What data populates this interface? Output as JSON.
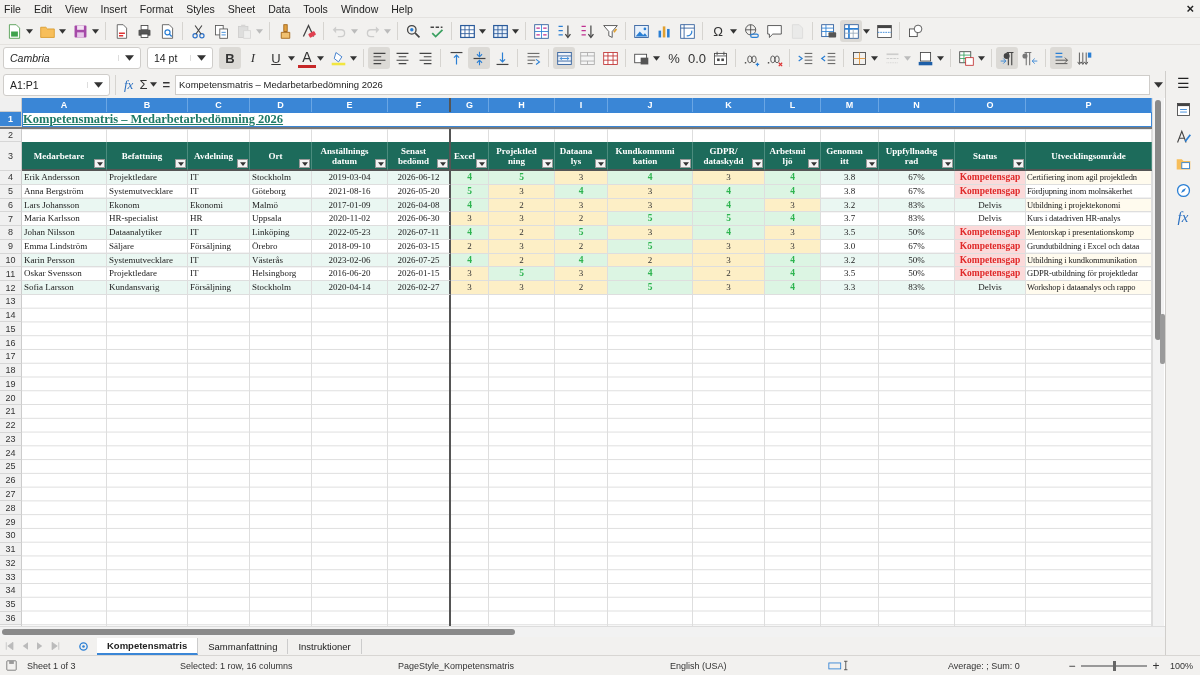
{
  "menu": [
    "File",
    "Edit",
    "View",
    "Insert",
    "Format",
    "Styles",
    "Sheet",
    "Data",
    "Tools",
    "Window",
    "Help"
  ],
  "close": "×",
  "toolbar_1": [
    {
      "kind": "newdoc",
      "selected": false,
      "disabled": false,
      "dropdown": true
    },
    {
      "kind": "open",
      "selected": false,
      "disabled": false,
      "dropdown": true
    },
    {
      "kind": "save",
      "selected": false,
      "disabled": false,
      "dropdown": true
    },
    {
      "kind": "sep"
    },
    {
      "kind": "pdf",
      "selected": false,
      "disabled": false,
      "dropdown": false
    },
    {
      "kind": "print",
      "selected": false,
      "disabled": false,
      "dropdown": false
    },
    {
      "kind": "preview",
      "selected": false,
      "disabled": false,
      "dropdown": false
    },
    {
      "kind": "sep"
    },
    {
      "kind": "cut",
      "selected": false,
      "disabled": false,
      "dropdown": false
    },
    {
      "kind": "copy",
      "selected": false,
      "disabled": false,
      "dropdown": false
    },
    {
      "kind": "paste",
      "selected": false,
      "disabled": true,
      "dropdown": true
    },
    {
      "kind": "sep"
    },
    {
      "kind": "brush",
      "selected": false,
      "disabled": false,
      "dropdown": false
    },
    {
      "kind": "eraser",
      "selected": false,
      "disabled": false,
      "dropdown": false
    },
    {
      "kind": "sep"
    },
    {
      "kind": "undo",
      "selected": false,
      "disabled": true,
      "dropdown": true
    },
    {
      "kind": "redo",
      "selected": false,
      "disabled": true,
      "dropdown": true
    },
    {
      "kind": "sep"
    },
    {
      "kind": "find",
      "selected": false,
      "disabled": false,
      "dropdown": false
    },
    {
      "kind": "spell",
      "selected": false,
      "disabled": false,
      "dropdown": false
    },
    {
      "kind": "sep"
    },
    {
      "kind": "rows",
      "selected": false,
      "disabled": false,
      "dropdown": true
    },
    {
      "kind": "cols",
      "selected": false,
      "disabled": false,
      "dropdown": true
    },
    {
      "kind": "sep"
    },
    {
      "kind": "sort",
      "selected": false,
      "disabled": false,
      "dropdown": false
    },
    {
      "kind": "sortup",
      "selected": false,
      "disabled": false,
      "dropdown": false
    },
    {
      "kind": "sortdown",
      "selected": false,
      "disabled": false,
      "dropdown": false
    },
    {
      "kind": "filter",
      "selected": false,
      "disabled": false,
      "dropdown": false
    },
    {
      "kind": "sep"
    },
    {
      "kind": "image",
      "selected": false,
      "disabled": false,
      "dropdown": false
    },
    {
      "kind": "chart",
      "selected": false,
      "disabled": false,
      "dropdown": false
    },
    {
      "kind": "pivot",
      "selected": false,
      "disabled": false,
      "dropdown": false
    },
    {
      "kind": "sep"
    },
    {
      "kind": "glyph",
      "label": "Ω",
      "selected": false,
      "disabled": false,
      "dropdown": true
    },
    {
      "kind": "link",
      "selected": false,
      "disabled": false,
      "dropdown": false
    },
    {
      "kind": "comment",
      "selected": false,
      "disabled": false,
      "dropdown": false
    },
    {
      "kind": "page",
      "selected": false,
      "disabled": true,
      "dropdown": false
    },
    {
      "kind": "sep"
    },
    {
      "kind": "printarea",
      "selected": false,
      "disabled": false,
      "dropdown": false
    },
    {
      "kind": "freeze",
      "selected": true,
      "disabled": false,
      "dropdown": true
    },
    {
      "kind": "split",
      "selected": false,
      "disabled": false,
      "dropdown": false
    },
    {
      "kind": "sep"
    },
    {
      "kind": "shapes",
      "selected": false,
      "disabled": false,
      "dropdown": false
    }
  ],
  "font_name": "Cambria",
  "font_size": "14 pt",
  "toolbar_2": [
    {
      "kind": "glyph",
      "label": "B",
      "selected": true,
      "disabled": false,
      "dropdown": false
    },
    {
      "kind": "glyph",
      "label": "I",
      "selected": false,
      "disabled": false,
      "dropdown": false
    },
    {
      "kind": "glyph",
      "label": "U",
      "selected": false,
      "disabled": false,
      "dropdown": true
    },
    {
      "kind": "fontcolor",
      "label": "A",
      "selected": false,
      "disabled": false,
      "dropdown": true
    },
    {
      "kind": "highlight",
      "selected": false,
      "disabled": false,
      "dropdown": true
    },
    {
      "kind": "sep"
    },
    {
      "kind": "alignleft",
      "selected": true,
      "disabled": false,
      "dropdown": false
    },
    {
      "kind": "aligncenter",
      "selected": false,
      "disabled": false,
      "dropdown": false
    },
    {
      "kind": "alignright",
      "selected": false,
      "disabled": false,
      "dropdown": false
    },
    {
      "kind": "sep"
    },
    {
      "kind": "top",
      "selected": false,
      "disabled": false,
      "dropdown": false
    },
    {
      "kind": "vcenter",
      "selected": true,
      "disabled": false,
      "dropdown": false
    },
    {
      "kind": "bottom",
      "selected": false,
      "disabled": false,
      "dropdown": false
    },
    {
      "kind": "sep"
    },
    {
      "kind": "wrap",
      "selected": false,
      "disabled": false,
      "dropdown": false
    },
    {
      "kind": "sep"
    },
    {
      "kind": "mergecenter",
      "selected": true,
      "disabled": false,
      "dropdown": false
    },
    {
      "kind": "merge",
      "selected": false,
      "disabled": false,
      "dropdown": false
    },
    {
      "kind": "unmerge",
      "selected": false,
      "disabled": false,
      "dropdown": false
    },
    {
      "kind": "sep"
    },
    {
      "kind": "numfmt",
      "selected": false,
      "disabled": false,
      "dropdown": true
    },
    {
      "kind": "glyph",
      "label": "%",
      "selected": false,
      "disabled": false,
      "dropdown": false
    },
    {
      "kind": "glyph",
      "label": "0.0",
      "selected": false,
      "disabled": false,
      "dropdown": false
    },
    {
      "kind": "date",
      "selected": false,
      "disabled": false,
      "dropdown": false
    },
    {
      "kind": "sep"
    },
    {
      "kind": "adddec",
      "selected": false,
      "disabled": false,
      "dropdown": false
    },
    {
      "kind": "deldec",
      "selected": false,
      "disabled": false,
      "dropdown": false
    },
    {
      "kind": "sep"
    },
    {
      "kind": "indent",
      "selected": false,
      "disabled": false,
      "dropdown": false
    },
    {
      "kind": "outdent",
      "selected": false,
      "disabled": false,
      "dropdown": false
    },
    {
      "kind": "sep"
    },
    {
      "kind": "borders",
      "selected": false,
      "disabled": false,
      "dropdown": true
    },
    {
      "kind": "borderstyle",
      "selected": false,
      "disabled": true,
      "dropdown": true
    },
    {
      "kind": "bordercolor",
      "selected": false,
      "disabled": false,
      "dropdown": true
    },
    {
      "kind": "sep"
    },
    {
      "kind": "condfmt",
      "selected": false,
      "disabled": false,
      "dropdown": true
    },
    {
      "kind": "sep"
    },
    {
      "kind": "ltr",
      "selected": true,
      "disabled": false,
      "dropdown": false
    },
    {
      "kind": "rtl",
      "selected": false,
      "disabled": false,
      "dropdown": false
    },
    {
      "kind": "sep"
    },
    {
      "kind": "textdir",
      "selected": true,
      "disabled": false,
      "dropdown": false
    },
    {
      "kind": "vtext",
      "selected": false,
      "disabled": false,
      "dropdown": false
    }
  ],
  "formula_bar": {
    "name_box": "A1:P1",
    "function_wizard": "fx",
    "sum": "Σ",
    "equals": "=",
    "content": "Kompetensmatris – Medarbetarbedömning 2026"
  },
  "sidebar": {
    "menu": "☰",
    "functions": "fx"
  },
  "sheet": {
    "column_headers": [
      {
        "label": "A",
        "selected": true
      },
      {
        "label": "B",
        "selected": true
      },
      {
        "label": "C",
        "selected": true
      },
      {
        "label": "D",
        "selected": true
      },
      {
        "label": "E",
        "selected": true
      },
      {
        "label": "F",
        "selected": true
      },
      {
        "label": "G",
        "selected": true
      },
      {
        "label": "H",
        "selected": true
      },
      {
        "label": "I",
        "selected": true
      },
      {
        "label": "J",
        "selected": true
      },
      {
        "label": "K",
        "selected": true
      },
      {
        "label": "L",
        "selected": true
      },
      {
        "label": "M",
        "selected": true
      },
      {
        "label": "N",
        "selected": true
      },
      {
        "label": "O",
        "selected": true
      },
      {
        "label": "P",
        "selected": true
      }
    ],
    "row_headers": [
      {
        "label": "1",
        "selected": true
      },
      {
        "label": "2",
        "selected": false
      },
      {
        "label": "3",
        "selected": false
      },
      {
        "label": "4",
        "selected": false
      },
      {
        "label": "5",
        "selected": false
      },
      {
        "label": "6",
        "selected": false
      },
      {
        "label": "7",
        "selected": false
      },
      {
        "label": "8",
        "selected": false
      },
      {
        "label": "9",
        "selected": false
      },
      {
        "label": "10",
        "selected": false
      },
      {
        "label": "11",
        "selected": false
      },
      {
        "label": "12",
        "selected": false
      },
      {
        "label": "13",
        "selected": false
      },
      {
        "label": "14",
        "selected": false
      },
      {
        "label": "15",
        "selected": false
      },
      {
        "label": "16",
        "selected": false
      },
      {
        "label": "17",
        "selected": false
      },
      {
        "label": "18",
        "selected": false
      },
      {
        "label": "19",
        "selected": false
      },
      {
        "label": "20",
        "selected": false
      },
      {
        "label": "21",
        "selected": false
      },
      {
        "label": "22",
        "selected": false
      },
      {
        "label": "23",
        "selected": false
      },
      {
        "label": "24",
        "selected": false
      },
      {
        "label": "25",
        "selected": false
      },
      {
        "label": "26",
        "selected": false
      },
      {
        "label": "27",
        "selected": false
      },
      {
        "label": "28",
        "selected": false
      },
      {
        "label": "29",
        "selected": false
      },
      {
        "label": "30",
        "selected": false
      },
      {
        "label": "31",
        "selected": false
      },
      {
        "label": "32",
        "selected": false
      },
      {
        "label": "33",
        "selected": false
      },
      {
        "label": "34",
        "selected": false
      },
      {
        "label": "35",
        "selected": false
      },
      {
        "label": "36",
        "selected": false
      }
    ],
    "title": "Kompetensmatris – Medarbetarbedömning 2026",
    "header_cells": [
      {
        "text": "Medarbetare",
        "filter": true
      },
      {
        "text": "Befattning",
        "filter": true
      },
      {
        "text": "Avdelning",
        "filter": true
      },
      {
        "text": "Ort",
        "filter": true
      },
      {
        "text": "Anställnings\ndatum",
        "filter": true
      },
      {
        "text": "Senast\nbedömd",
        "filter": true
      },
      {
        "text": "Excel",
        "filter": true
      },
      {
        "text": "Projektled\nning",
        "filter": true
      },
      {
        "text": "Dataana\nlys",
        "filter": true
      },
      {
        "text": "Kundkommuni\nkation",
        "filter": true
      },
      {
        "text": "GDPR/\ndataskydd",
        "filter": true
      },
      {
        "text": "Arbetsmi\nljö",
        "filter": true
      },
      {
        "text": "Genomsn\nitt",
        "filter": true
      },
      {
        "text": "Uppfyllnadsg\nrad",
        "filter": true
      },
      {
        "text": "Status",
        "filter": true
      },
      {
        "text": "Utvecklingsområde",
        "filter": false
      }
    ],
    "rows": [
      {
        "info": [
          "Erik Andersson",
          "Projektledare",
          "IT",
          "Stockholm",
          "2019-03-04",
          "2026-06-12"
        ],
        "skills": [
          {
            "score": "4",
            "good": true
          },
          {
            "score": "5",
            "good": true
          },
          {
            "score": "3",
            "good": false
          },
          {
            "score": "4",
            "good": true
          },
          {
            "score": "3",
            "good": false
          },
          {
            "score": "4",
            "good": true
          }
        ],
        "average": "3.8",
        "fulfilment": "67%",
        "status": "Kompetensgap",
        "gap": true,
        "development": "Certifiering inom agil projektledn"
      },
      {
        "info": [
          "Anna Bergström",
          "Systemutvecklare",
          "IT",
          "Göteborg",
          "2021-08-16",
          "2026-05-20"
        ],
        "skills": [
          {
            "score": "5",
            "good": true
          },
          {
            "score": "3",
            "good": false
          },
          {
            "score": "4",
            "good": true
          },
          {
            "score": "3",
            "good": false
          },
          {
            "score": "4",
            "good": true
          },
          {
            "score": "4",
            "good": true
          }
        ],
        "average": "3.8",
        "fulfilment": "67%",
        "status": "Kompetensgap",
        "gap": true,
        "development": "Fördjupning inom molnsäkerhet"
      },
      {
        "info": [
          "Lars Johansson",
          "Ekonom",
          "Ekonomi",
          "Malmö",
          "2017-01-09",
          "2026-04-08"
        ],
        "skills": [
          {
            "score": "4",
            "good": true
          },
          {
            "score": "2",
            "good": false
          },
          {
            "score": "3",
            "good": false
          },
          {
            "score": "3",
            "good": false
          },
          {
            "score": "4",
            "good": true
          },
          {
            "score": "3",
            "good": false
          }
        ],
        "average": "3.2",
        "fulfilment": "83%",
        "status": "Delvis",
        "gap": false,
        "development": "Utbildning i projektekonomi"
      },
      {
        "info": [
          "Maria Karlsson",
          "HR-specialist",
          "HR",
          "Uppsala",
          "2020-11-02",
          "2026-06-30"
        ],
        "skills": [
          {
            "score": "3",
            "good": false
          },
          {
            "score": "3",
            "good": false
          },
          {
            "score": "2",
            "good": false
          },
          {
            "score": "5",
            "good": true
          },
          {
            "score": "5",
            "good": true
          },
          {
            "score": "4",
            "good": true
          }
        ],
        "average": "3.7",
        "fulfilment": "83%",
        "status": "Delvis",
        "gap": false,
        "development": "Kurs i datadriven HR-analys"
      },
      {
        "info": [
          "Johan Nilsson",
          "Dataanalytiker",
          "IT",
          "Linköping",
          "2022-05-23",
          "2026-07-11"
        ],
        "skills": [
          {
            "score": "4",
            "good": true
          },
          {
            "score": "2",
            "good": false
          },
          {
            "score": "5",
            "good": true
          },
          {
            "score": "3",
            "good": false
          },
          {
            "score": "4",
            "good": true
          },
          {
            "score": "3",
            "good": false
          }
        ],
        "average": "3.5",
        "fulfilment": "50%",
        "status": "Kompetensgap",
        "gap": true,
        "development": "Mentorskap i presentationskomp"
      },
      {
        "info": [
          "Emma Lindström",
          "Säljare",
          "Försäljning",
          "Örebro",
          "2018-09-10",
          "2026-03-15"
        ],
        "skills": [
          {
            "score": "2",
            "good": false
          },
          {
            "score": "3",
            "good": false
          },
          {
            "score": "2",
            "good": false
          },
          {
            "score": "5",
            "good": true
          },
          {
            "score": "3",
            "good": false
          },
          {
            "score": "3",
            "good": false
          }
        ],
        "average": "3.0",
        "fulfilment": "67%",
        "status": "Kompetensgap",
        "gap": true,
        "development": "Grundutbildning i Excel och dataa"
      },
      {
        "info": [
          "Karin Persson",
          "Systemutvecklare",
          "IT",
          "Västerås",
          "2023-02-06",
          "2026-07-25"
        ],
        "skills": [
          {
            "score": "4",
            "good": true
          },
          {
            "score": "2",
            "good": false
          },
          {
            "score": "4",
            "good": true
          },
          {
            "score": "2",
            "good": false
          },
          {
            "score": "3",
            "good": false
          },
          {
            "score": "4",
            "good": true
          }
        ],
        "average": "3.2",
        "fulfilment": "50%",
        "status": "Kompetensgap",
        "gap": true,
        "development": "Utbildning i kundkommunikation"
      },
      {
        "info": [
          "Oskar Svensson",
          "Projektledare",
          "IT",
          "Helsingborg",
          "2016-06-20",
          "2026-01-15"
        ],
        "skills": [
          {
            "score": "3",
            "good": false
          },
          {
            "score": "5",
            "good": true
          },
          {
            "score": "3",
            "good": false
          },
          {
            "score": "4",
            "good": true
          },
          {
            "score": "2",
            "good": false
          },
          {
            "score": "4",
            "good": true
          }
        ],
        "average": "3.5",
        "fulfilment": "50%",
        "status": "Kompetensgap",
        "gap": true,
        "development": "GDPR-utbildning för projektledar"
      },
      {
        "info": [
          "Sofia Larsson",
          "Kundansvarig",
          "Försäljning",
          "Stockholm",
          "2020-04-14",
          "2026-02-27"
        ],
        "skills": [
          {
            "score": "3",
            "good": false
          },
          {
            "score": "3",
            "good": false
          },
          {
            "score": "2",
            "good": false
          },
          {
            "score": "5",
            "good": true
          },
          {
            "score": "3",
            "good": false
          },
          {
            "score": "4",
            "good": true
          }
        ],
        "average": "3.3",
        "fulfilment": "83%",
        "status": "Delvis",
        "gap": false,
        "development": "Workshop i dataanalys och rappo"
      }
    ]
  },
  "sheet_tabs": [
    {
      "label": "Kompetensmatris",
      "selected": true
    },
    {
      "label": "Sammanfattning",
      "selected": false
    },
    {
      "label": "Instruktioner",
      "selected": false
    }
  ],
  "status_bar": {
    "sheet": "Sheet 1 of 3",
    "selection": "Selected: 1 row, 16 columns",
    "page_style": "PageStyle_Kompetensmatris",
    "language": "English (USA)",
    "summary": "Average: ; Sum: 0",
    "zoom_out": "−",
    "zoom_in": "+",
    "zoom": {
      "level": 0.5
    },
    "zoom_percent": "100%"
  }
}
